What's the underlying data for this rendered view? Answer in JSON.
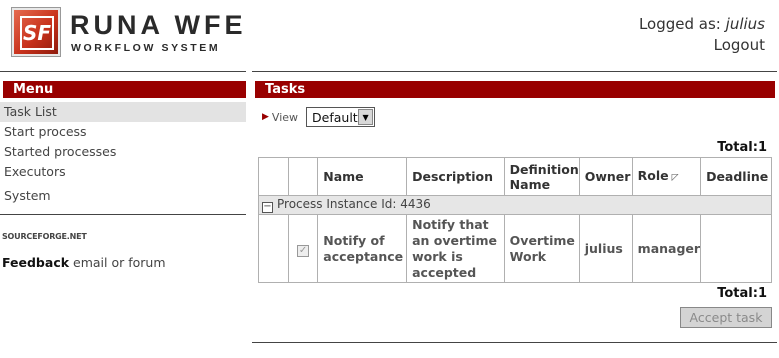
{
  "header": {
    "logo_mark": "SF",
    "logo_title": "RUNA WFE",
    "logo_subtitle": "WORKFLOW SYSTEM",
    "logged_as_label": "Logged as:",
    "username": "julius",
    "logout_label": "Logout"
  },
  "menu": {
    "title": "Menu",
    "items": [
      {
        "label": "Task List"
      },
      {
        "label": "Start process"
      },
      {
        "label": "Started processes"
      },
      {
        "label": "Executors"
      },
      {
        "label": "System"
      }
    ],
    "sourceforge_label": "SOURCEFORGE.NET",
    "feedback_label": "Feedback",
    "feedback_text": "email or forum"
  },
  "tasks": {
    "title": "Tasks",
    "view_label": "View",
    "view_selected": "Default",
    "total_top": "Total:1",
    "total_bottom": "Total:1",
    "columns": [
      "Name",
      "Description",
      "Definition Name",
      "Owner",
      "Role",
      "Deadline"
    ],
    "group_label": "Process Instance Id: 4436",
    "rows": [
      {
        "name": "Notify of acceptance",
        "description": "Notify that an overtime work is accepted",
        "definition_name": "Overtime Work",
        "owner": "julius",
        "role": "manager",
        "deadline": ""
      }
    ],
    "accept_button": "Accept task"
  },
  "colors": {
    "header_bar": "#990000",
    "selected_menu": "#e3e3e3",
    "group_row": "#e6e6e6"
  },
  "icons": [
    "sort-icon",
    "collapse-icon",
    "checkbox-icon",
    "dropdown-arrow-icon"
  ]
}
